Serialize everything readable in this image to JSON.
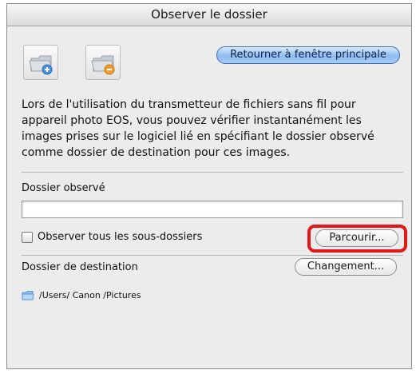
{
  "window": {
    "title": "Observer le dossier"
  },
  "toolbar": {
    "add_folder_icon": "folder-add-icon",
    "remove_folder_icon": "folder-remove-icon",
    "return_label": "Retourner à fenêtre principale"
  },
  "description": "Lors de l'utilisation du transmetteur de fichiers sans fil pour appareil photo EOS, vous pouvez vérifier instantanément les images prises sur le logiciel lié en spécifiant le dossier observé comme dossier de destination pour ces images.",
  "watched": {
    "label": "Dossier observé",
    "path_value": "",
    "subfolders_label": "Observer tous les sous-dossiers",
    "subfolders_checked": false,
    "browse_label": "Parcourir..."
  },
  "destination": {
    "label": "Dossier de destination",
    "change_label": "Changement...",
    "path": "/Users/ Canon /Pictures",
    "folder_icon": "folder-icon"
  },
  "colors": {
    "highlight": "#e01818",
    "accent_button": "#8fbbef",
    "add_badge": "#4a8fd9",
    "remove_badge": "#f0a030"
  }
}
